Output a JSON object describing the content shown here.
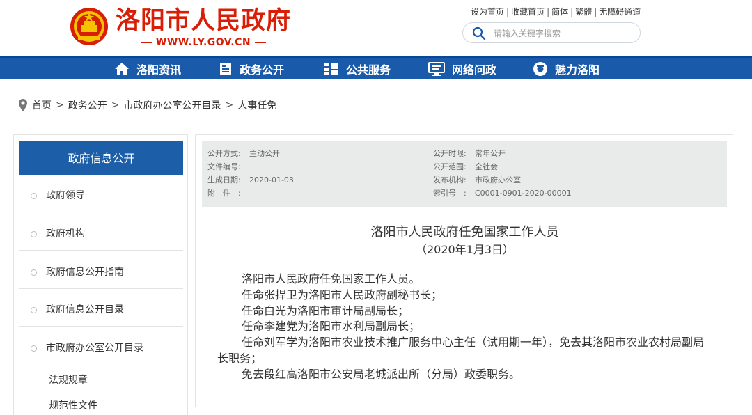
{
  "header": {
    "site_title": "洛阳市人民政府",
    "site_url": "WWW.LY.GOV.CN",
    "top_links": [
      "设为首页",
      "收藏首页",
      "简体",
      "繁體",
      "无障碍通道"
    ],
    "search_placeholder": "请输入关键字搜索"
  },
  "nav": {
    "items": [
      {
        "label": "洛阳资讯",
        "icon": "home-icon"
      },
      {
        "label": "政务公开",
        "icon": "document-icon"
      },
      {
        "label": "公共服务",
        "icon": "grid-icon"
      },
      {
        "label": "网络问政",
        "icon": "monitor-icon"
      },
      {
        "label": "魅力洛阳",
        "icon": "camera-icon"
      }
    ]
  },
  "breadcrumb": [
    "首页",
    "政务公开",
    "市政府办公室公开目录",
    "人事任免"
  ],
  "sidebar": {
    "title": "政府信息公开",
    "items": [
      "政府领导",
      "政府机构",
      "政府信息公开指南",
      "政府信息公开目录",
      "市政府办公室公开目录"
    ],
    "sub_items": [
      "法规规章",
      "规范性文件"
    ]
  },
  "meta": {
    "disclosure_method_label": "公开方式:",
    "disclosure_method": "主动公开",
    "doc_number_label": "文件编号:",
    "doc_number": "",
    "effective_date_label": "生成日期:",
    "effective_date": "2020-01-03",
    "attachment_label": "附　件　:",
    "attachment": "",
    "disclosure_time_label": "公开时限:",
    "disclosure_time": "常年公开",
    "disclosure_scope_label": "公开范围:",
    "disclosure_scope": "全社会",
    "publisher_label": "发布机构:",
    "publisher": "市政府办公室",
    "index_label": "索引号　:",
    "index_number": "C0001-0901-2020-00001"
  },
  "article": {
    "title": "洛阳市人民政府任免国家工作人员",
    "date": "（2020年1月3日）",
    "paragraphs": [
      "洛阳市人民政府任免国家工作人员。",
      "任命张捍卫为洛阳市人民政府副秘书长；",
      "任命白光为洛阳市审计局副局长；",
      "任命李建党为洛阳市水利局副局长；",
      "任命刘军学为洛阳市农业技术推广服务中心主任（试用期一年），免去其洛阳市农业农村局副局长职务；",
      "免去段红高洛阳市公安局老城派出所（分局）政委职务。"
    ]
  },
  "colors": {
    "brand_red": "#d81e06",
    "nav_blue": "#1a5aaa",
    "sidebar_blue": "#1d5ea8"
  }
}
